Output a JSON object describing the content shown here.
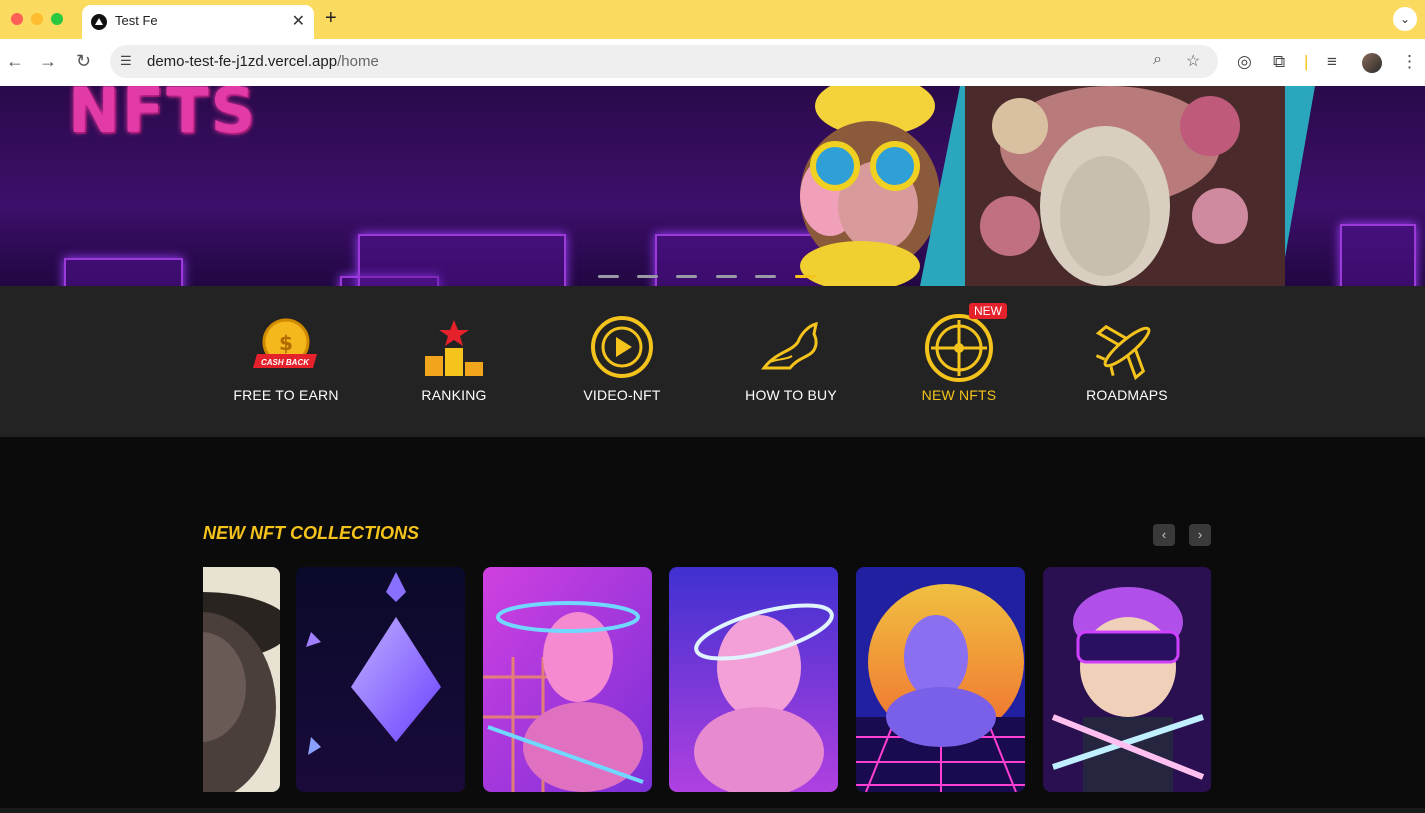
{
  "browser": {
    "tab_title": "Test Fe",
    "url_host": "demo-test-fe-j1zd.vercel.app",
    "url_path": "/home",
    "icons": [
      "back-icon",
      "forward-icon",
      "reload-icon",
      "site-info-icon",
      "zoom-icon",
      "bookmark-star-icon",
      "compass-icon",
      "extensions-icon",
      "media-icon",
      "menu-kebab-icon"
    ]
  },
  "hero": {
    "title": "NFTS",
    "slides_count": 6,
    "active_slide": 6
  },
  "categories": [
    {
      "label": "FREE TO EARN",
      "icon": "cash-back-coin-icon",
      "badge_text": "CASH BACK"
    },
    {
      "label": "RANKING",
      "icon": "podium-icon"
    },
    {
      "label": "VIDEO-NFT",
      "icon": "play-circle-icon"
    },
    {
      "label": "HOW TO BUY",
      "icon": "horse-icon"
    },
    {
      "label": "NEW NFTS",
      "icon": "roulette-wheel-icon",
      "badge": "NEW",
      "active": true
    },
    {
      "label": "ROADMAPS",
      "icon": "airplane-icon"
    }
  ],
  "collections": {
    "title": "NEW NFT COLLECTIONS",
    "prev": "‹",
    "next": "›",
    "cards": [
      "hooded-figure-nft",
      "crystal-ethereum-nft",
      "pink-statue-grid-nft",
      "halo-statue-nft",
      "synthwave-venus-nft",
      "cyber-boy-nft"
    ]
  },
  "colors": {
    "accent": "#f4c31c",
    "tabbar": "#fadb5f",
    "badge": "#e5212c",
    "hero_title": "#e23aa6"
  }
}
